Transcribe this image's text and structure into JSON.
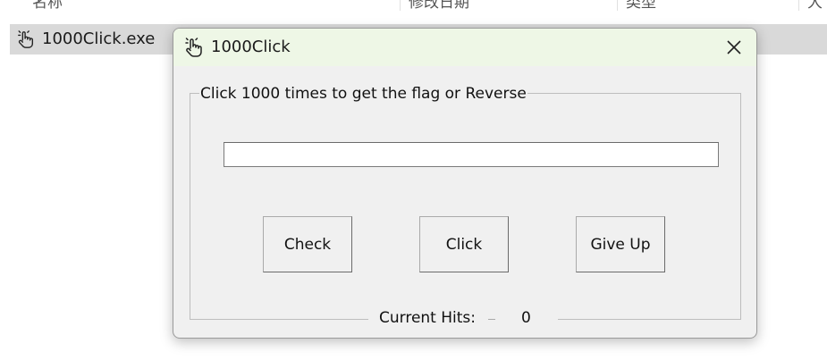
{
  "explorer": {
    "columns": [
      "名称",
      "修改日期",
      "类型",
      "大"
    ],
    "file": {
      "name": "1000Click.exe",
      "icon": "touch-hand-icon"
    }
  },
  "dialog": {
    "title": "1000Click",
    "icon": "touch-hand-icon",
    "close_icon": "close-icon",
    "group_label": "Click 1000 times to get the flag or Reverse",
    "input": {
      "value": "",
      "placeholder": ""
    },
    "buttons": {
      "check": "Check",
      "click": "Click",
      "give_up": "Give Up"
    },
    "hits": {
      "label": "Current Hits:",
      "value": "0"
    }
  }
}
